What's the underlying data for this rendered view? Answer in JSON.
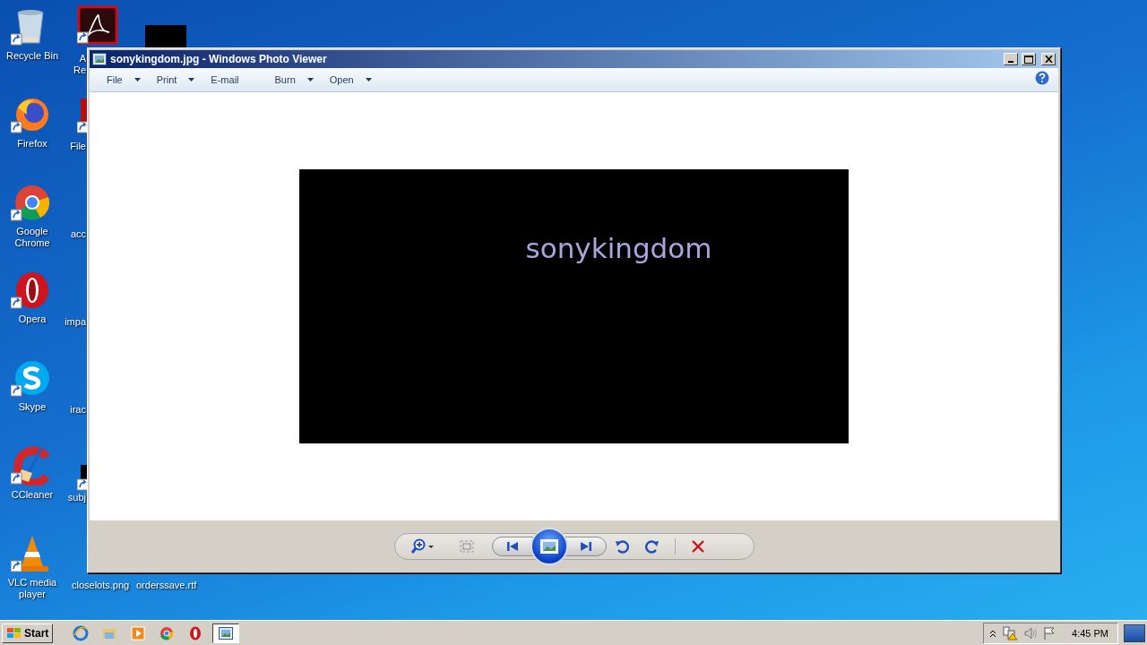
{
  "desktop_icons": [
    {
      "label": "Recycle Bin",
      "kind": "recycle"
    },
    {
      "label": "Firefox",
      "kind": "firefox"
    },
    {
      "label": "Google Chrome",
      "kind": "chrome"
    },
    {
      "label": "Opera",
      "kind": "opera"
    },
    {
      "label": "Skype",
      "kind": "skype"
    },
    {
      "label": "CCleaner",
      "kind": "ccleaner"
    },
    {
      "label": "VLC media player",
      "kind": "vlc"
    }
  ],
  "partial_icons": [
    {
      "label": "A\nRe",
      "kind": "acrobat"
    },
    {
      "label": "File",
      "kind": "redfile"
    },
    {
      "label": "acc",
      "kind": "none"
    },
    {
      "label": "impa",
      "kind": "none"
    },
    {
      "label": "irac",
      "kind": "none"
    },
    {
      "label": "subj",
      "kind": "blackfile"
    }
  ],
  "bottom_icons": [
    {
      "label": "closelots.png"
    },
    {
      "label": "orderssave.rtf"
    }
  ],
  "window": {
    "title": "sonykingdom.jpg - Windows Photo Viewer",
    "menu": [
      {
        "label": "File",
        "dropdown": true
      },
      {
        "label": "Print",
        "dropdown": true
      },
      {
        "label": "E-mail",
        "dropdown": false
      },
      {
        "label": "Burn",
        "dropdown": true
      },
      {
        "label": "Open",
        "dropdown": true
      }
    ],
    "image_text": "sonykingdom",
    "controls": [
      {
        "kind": "zoom"
      },
      {
        "kind": "fit"
      },
      {
        "kind": "prev"
      },
      {
        "kind": "slideshow"
      },
      {
        "kind": "next"
      },
      {
        "kind": "rotate-left"
      },
      {
        "kind": "rotate-right"
      },
      {
        "kind": "separator"
      },
      {
        "kind": "delete"
      }
    ]
  },
  "taskbar": {
    "start": "Start",
    "quick_launch": [
      {
        "kind": "ie"
      },
      {
        "kind": "folder"
      },
      {
        "kind": "media"
      },
      {
        "kind": "chrome"
      },
      {
        "kind": "opera"
      }
    ],
    "tasks": [
      {
        "kind": "photoviewer",
        "selected": true
      }
    ],
    "clock": "4:45 PM"
  }
}
